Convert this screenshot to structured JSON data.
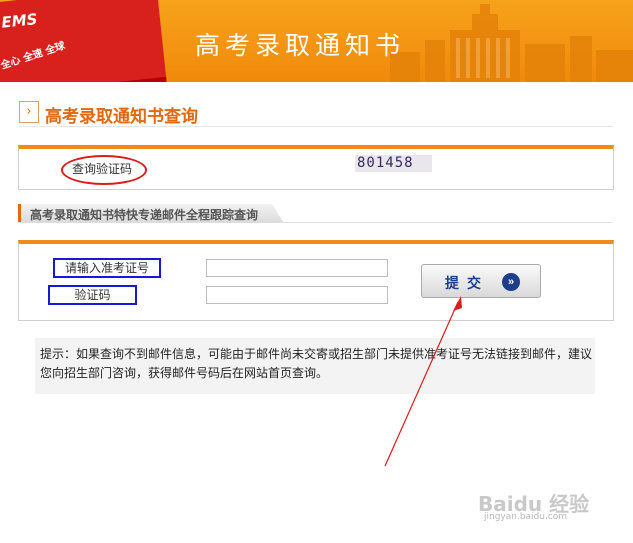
{
  "banner": {
    "title": "高考录取通知书",
    "logo_text": "EMS",
    "slogan": "全心 全速 全球"
  },
  "query_section": {
    "title": "高考录取通知书查询",
    "icon": "chevron-right-icon",
    "verify_label": "查询验证码",
    "captcha_code": "801458"
  },
  "tracking_section": {
    "tab_title": "高考录取通知书特快专递邮件全程跟踪查询"
  },
  "form": {
    "exam_number_label": "请输入准考证号",
    "exam_number_value": "",
    "captcha_label": "验证码",
    "captcha_value": "",
    "submit_label": "提交",
    "submit_icon": "double-chevron-right-icon"
  },
  "tip": {
    "text": "提示：如果查询不到邮件信息，可能由于邮件尚未交寄或招生部门未提供准考证号无法链接到邮件，建议您向招生部门咨询，获得邮件号码后在网站首页查询。"
  },
  "watermark": {
    "brand": "Baidu 经验",
    "url": "jingyan.baidu.com"
  },
  "colors": {
    "banner_orange": "#f08a0c",
    "accent_orange": "#e4680e",
    "annotation_red": "#d91c1c",
    "annotation_blue": "#1a18d8",
    "button_navy": "#1d3f8a"
  }
}
